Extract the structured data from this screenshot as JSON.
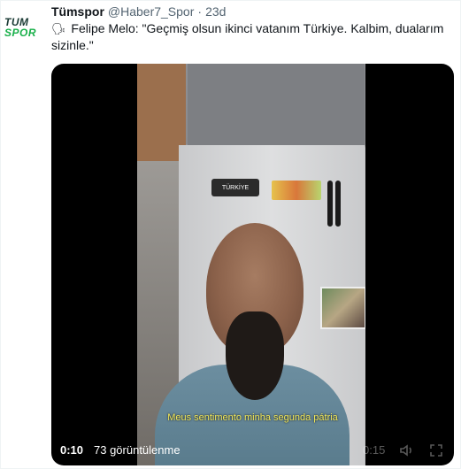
{
  "tweet": {
    "avatar": {
      "line1": "TUM",
      "line2": "SPOR"
    },
    "name": "Tümspor",
    "handle": "@Haber7_Spor",
    "separator": "·",
    "time": "23d",
    "emoji": "speaking-head-icon",
    "text": "Felipe Melo: \"Geçmiş olsun ikinci vatanım Türkiye. Kalbim, dualarım sizinle.\""
  },
  "video": {
    "sticker_text": "TÜRKİYE",
    "subtitle": "Meus sentimento minha segunda pátria",
    "current_time": "0:10",
    "views": "73 görüntülenme",
    "remaining_time": "0:15",
    "icons": {
      "audio": "audio-settings-icon",
      "fullscreen": "expand-icon"
    }
  }
}
